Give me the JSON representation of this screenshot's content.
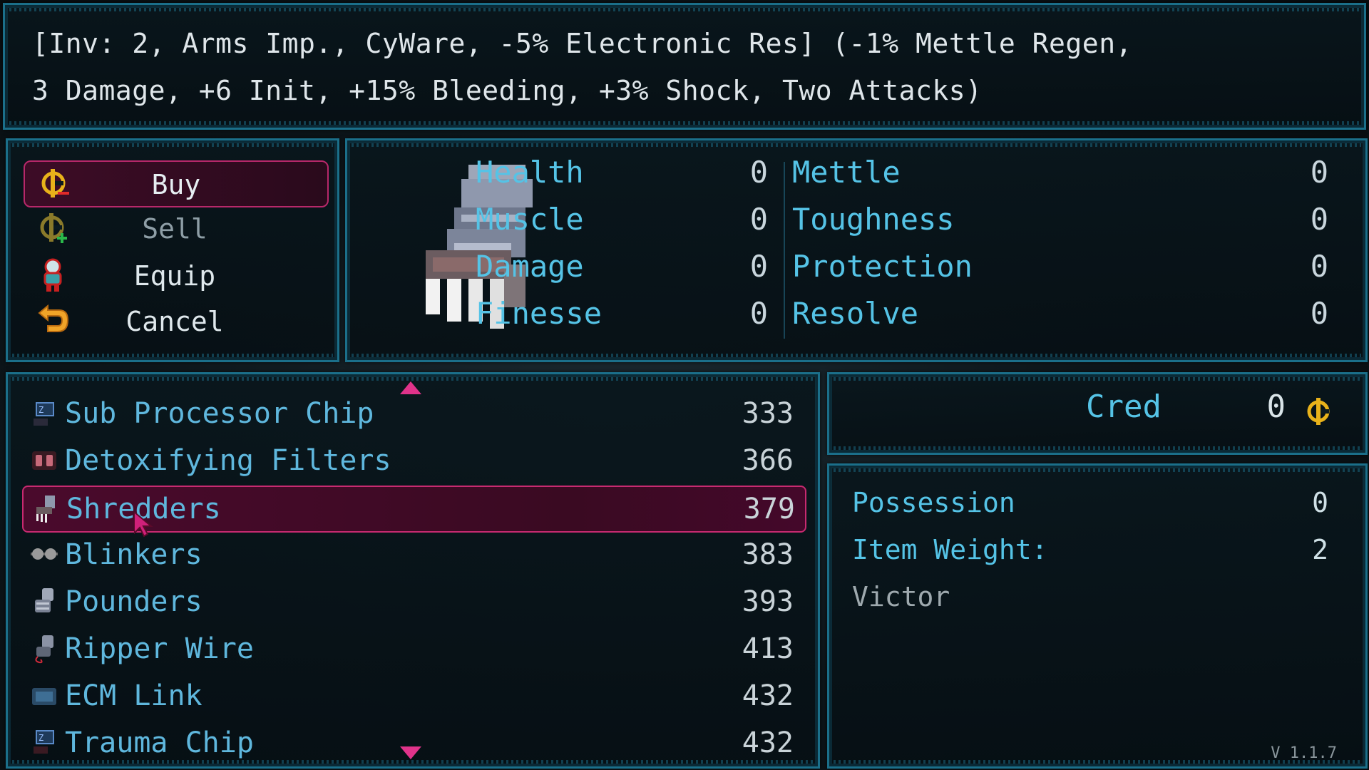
{
  "description": {
    "line1": "[Inv: 2, Arms Imp., CyWare, -5% Electronic Res] (-1% Mettle Regen,",
    "line2": "3 Damage, +6 Init, +15% Bleeding, +3% Shock, Two Attacks)"
  },
  "actions": [
    {
      "label": "Buy",
      "icon": "cred-minus-icon",
      "selected": true
    },
    {
      "label": "Sell",
      "icon": "cred-plus-icon",
      "selected": false
    },
    {
      "label": "Equip",
      "icon": "character-icon",
      "selected": false
    },
    {
      "label": "Cancel",
      "icon": "back-arrow-icon",
      "selected": false
    }
  ],
  "stats": {
    "left": [
      {
        "label": "Health",
        "value": "0"
      },
      {
        "label": "Muscle",
        "value": "0"
      },
      {
        "label": "Damage",
        "value": "0"
      },
      {
        "label": "Finesse",
        "value": "0"
      }
    ],
    "right": [
      {
        "label": "Mettle",
        "value": "0"
      },
      {
        "label": "Toughness",
        "value": "0"
      },
      {
        "label": "Protection",
        "value": "0"
      },
      {
        "label": "Resolve",
        "value": "0"
      }
    ]
  },
  "items": [
    {
      "name": "Sub Processor Chip",
      "price": "333",
      "icon": "chip-icon"
    },
    {
      "name": "Detoxifying Filters",
      "price": "366",
      "icon": "filter-icon"
    },
    {
      "name": "Shredders",
      "price": "379",
      "icon": "claw-gauntlet-icon",
      "selected": true
    },
    {
      "name": "Blinkers",
      "price": "383",
      "icon": "goggles-icon"
    },
    {
      "name": "Pounders",
      "price": "393",
      "icon": "gauntlet-icon"
    },
    {
      "name": "Ripper Wire",
      "price": "413",
      "icon": "wire-gauntlet-icon"
    },
    {
      "name": "ECM Link",
      "price": "432",
      "icon": "ecm-icon"
    },
    {
      "name": "Trauma Chip",
      "price": "432",
      "icon": "chip-icon"
    }
  ],
  "cred": {
    "label": "Cred",
    "value": "0",
    "icon": "cred-icon"
  },
  "info": {
    "possession_label": "Possession",
    "possession_value": "0",
    "weight_label": "Item Weight:",
    "weight_value": "2",
    "owner": "Victor"
  },
  "version": "V 1.1.7",
  "colors": {
    "accent_pink": "#c82a70",
    "stat_blue": "#55c3e6",
    "item_blue": "#5fb7dd",
    "border": "#1b6f8a"
  }
}
